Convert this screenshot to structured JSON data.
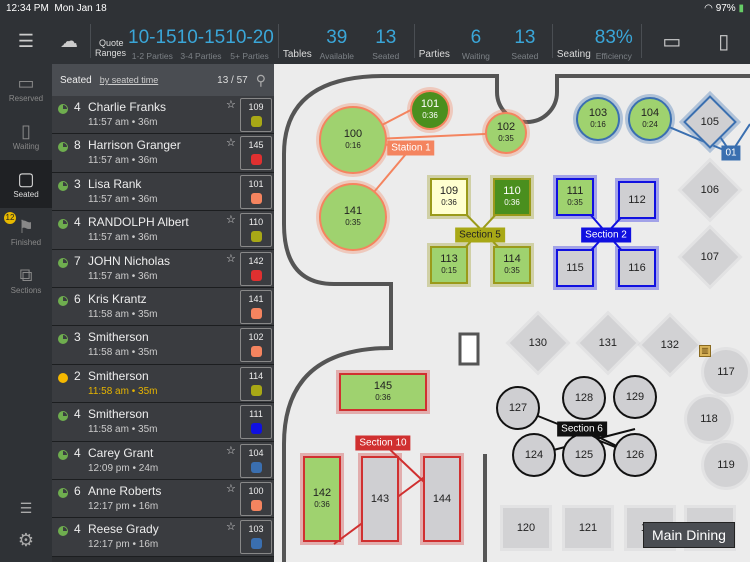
{
  "status": {
    "time": "12:34 PM",
    "date": "Mon Jan 18",
    "battery": "97%"
  },
  "header": {
    "quote": "Quote",
    "ranges": "Ranges",
    "quote_ranges": [
      {
        "value": "10-15",
        "label": "1-2 Parties"
      },
      {
        "value": "10-15",
        "label": "3-4 Parties"
      },
      {
        "value": "10-20",
        "label": "5+ Parties"
      }
    ],
    "tables_label": "Tables",
    "tables_available": "39",
    "available_label": "Available",
    "tables_seated": "13",
    "seated_label": "Seated",
    "parties_label": "Parties",
    "parties_waiting": "6",
    "waiting_label": "Waiting",
    "parties_seated": "13",
    "seating_label": "Seating",
    "efficiency": "83%",
    "efficiency_label": "Efficiency"
  },
  "rail": [
    {
      "label": "Reserved"
    },
    {
      "label": "Waiting"
    },
    {
      "label": "Seated"
    },
    {
      "label": "Finished",
      "badge": "12"
    },
    {
      "label": "Sections"
    }
  ],
  "list": {
    "title": "Seated",
    "sort": "by seated time",
    "count": "13 / 57",
    "rows": [
      {
        "size": "4",
        "name": "Charlie Franks",
        "time": "11:57 am • 36m",
        "star": true,
        "table": "109",
        "color": "#a8a816"
      },
      {
        "size": "8",
        "name": "Harrison Granger",
        "time": "11:57 am • 36m",
        "star": true,
        "table": "145",
        "color": "#e03030"
      },
      {
        "size": "3",
        "name": "Lisa Rank",
        "time": "11:57 am • 36m",
        "star": false,
        "table": "101",
        "color": "#f4845f"
      },
      {
        "size": "4",
        "name": "RANDOLPH Albert",
        "time": "11:57 am • 36m",
        "star": true,
        "table": "110",
        "color": "#a8a816"
      },
      {
        "size": "7",
        "name": "JOHN Nicholas",
        "time": "11:57 am • 36m",
        "star": true,
        "table": "142",
        "color": "#e03030"
      },
      {
        "size": "6",
        "name": "Kris Krantz",
        "time": "11:58 am • 35m",
        "star": false,
        "table": "141",
        "color": "#f4845f"
      },
      {
        "size": "3",
        "name": "Smitherson",
        "time": "11:58 am • 35m",
        "star": false,
        "table": "102",
        "color": "#f4845f"
      },
      {
        "size": "2",
        "name": "Smitherson",
        "time": "11:58 am • 35m",
        "star": false,
        "table": "114",
        "color": "#a8a816",
        "warn": true
      },
      {
        "size": "4",
        "name": "Smitherson",
        "time": "11:58 am • 35m",
        "star": false,
        "table": "111",
        "color": "#1010e0"
      },
      {
        "size": "4",
        "name": "Carey Grant",
        "time": "12:09 pm • 24m",
        "star": true,
        "table": "104",
        "color": "#3a6fb0"
      },
      {
        "size": "6",
        "name": "Anne Roberts",
        "time": "12:17 pm • 16m",
        "star": true,
        "table": "100",
        "color": "#f4845f"
      },
      {
        "size": "4",
        "name": "Reese Grady",
        "time": "12:17 pm • 16m",
        "star": true,
        "table": "103",
        "color": "#3a6fb0"
      }
    ]
  },
  "tables": {
    "100": {
      "num": "100",
      "time": "0:16"
    },
    "101": {
      "num": "101",
      "time": "0:36"
    },
    "102": {
      "num": "102",
      "time": "0:35"
    },
    "141": {
      "num": "141",
      "time": "0:35"
    },
    "103": {
      "num": "103",
      "time": "0:16"
    },
    "104": {
      "num": "104",
      "time": "0:24"
    },
    "105": {
      "num": "105"
    },
    "106": {
      "num": "106"
    },
    "107": {
      "num": "107"
    },
    "109": {
      "num": "109",
      "time": "0:36"
    },
    "110": {
      "num": "110",
      "time": "0:36"
    },
    "113": {
      "num": "113",
      "time": "0:15"
    },
    "114": {
      "num": "114",
      "time": "0:35"
    },
    "111": {
      "num": "111",
      "time": "0:35"
    },
    "112": {
      "num": "112"
    },
    "115": {
      "num": "115"
    },
    "116": {
      "num": "116"
    },
    "130": {
      "num": "130"
    },
    "131": {
      "num": "131"
    },
    "132": {
      "num": "132"
    },
    "117": {
      "num": "117"
    },
    "118": {
      "num": "118"
    },
    "119": {
      "num": "119"
    },
    "127": {
      "num": "127"
    },
    "128": {
      "num": "128"
    },
    "129": {
      "num": "129"
    },
    "124": {
      "num": "124"
    },
    "125": {
      "num": "125"
    },
    "126": {
      "num": "126"
    },
    "145": {
      "num": "145",
      "time": "0:36"
    },
    "142": {
      "num": "142",
      "time": "0:36"
    },
    "143": {
      "num": "143"
    },
    "144": {
      "num": "144"
    },
    "120": {
      "num": "120"
    },
    "121": {
      "num": "121"
    },
    "122": {
      "num": "122"
    },
    "123": {
      "num": "123"
    }
  },
  "sections": {
    "station1": "Station 1",
    "section5": "Section 5",
    "section2": "Section 2",
    "s01": "01",
    "section6": "Section 6",
    "section10": "Section 10"
  },
  "room": "Main Dining"
}
